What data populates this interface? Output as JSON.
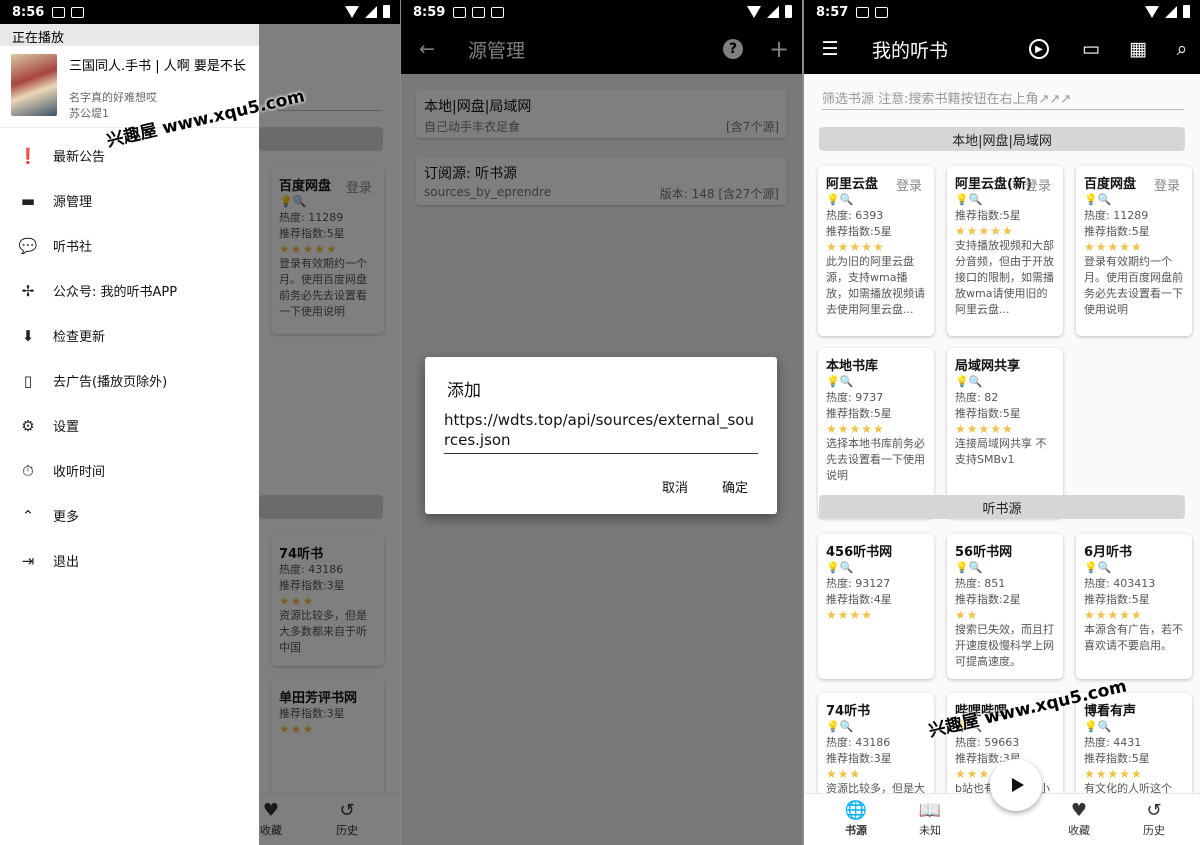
{
  "panel1": {
    "status": {
      "time": "8:56"
    },
    "now_playing": {
      "header": "正在播放",
      "title": "三国同人.手书 | 人啊 要是不长",
      "subtitle1": "名字真的好难想哎",
      "subtitle2": "苏公堤1"
    },
    "menu": [
      {
        "label": "最新公告",
        "icon": "announcement-icon",
        "glyph": "❗"
      },
      {
        "label": "源管理",
        "icon": "folder-icon",
        "glyph": "▬"
      },
      {
        "label": "听书社",
        "icon": "forum-icon",
        "glyph": "💬"
      },
      {
        "label": "公众号: 我的听书APP",
        "icon": "pinwheel-icon",
        "glyph": "✢"
      },
      {
        "label": "检查更新",
        "icon": "update-icon",
        "glyph": "⬇"
      },
      {
        "label": "去广告(播放页除外)",
        "icon": "phone-icon",
        "glyph": "▯"
      },
      {
        "label": "设置",
        "icon": "settings-icon",
        "glyph": "⚙"
      },
      {
        "label": "收听时间",
        "icon": "timer-icon",
        "glyph": "⏱"
      },
      {
        "label": "更多",
        "icon": "expand-icon",
        "glyph": "⌃"
      },
      {
        "label": "退出",
        "icon": "exit-icon",
        "glyph": "⇥"
      }
    ],
    "bg_card1": {
      "title": "百度网盘",
      "login": "登录",
      "hot": "热度: 11289",
      "rec": "推荐指数:5星",
      "desc": "登录有效期约一个月。使用百度网盘前务必先去设置看一下使用说明"
    },
    "bg_card2": {
      "title": "74听书",
      "hot": "热度: 43186",
      "rec": "推荐指数:3星",
      "desc": "资源比较多，但是大多数都来自于听中国"
    },
    "bg_card3": {
      "title": "单田芳评书网",
      "rec": "推荐指数:3星"
    },
    "nav": {
      "fav": "收藏",
      "history": "历史"
    },
    "watermark": "兴趣屋 www.xqu5.com"
  },
  "panel2": {
    "status": {
      "time": "8:59"
    },
    "title": "源管理",
    "sources": [
      {
        "title": "本地|网盘|局域网",
        "sub": "自己动手丰衣足食",
        "right": "[含7个源]"
      },
      {
        "title": "订阅源: 听书源",
        "sub": "sources_by_eprendre",
        "right": "版本: 148 [含27个源]"
      }
    ],
    "dialog": {
      "title": "添加",
      "input_value": "https://wdts.top/api/sources/external_sources.json",
      "cancel": "取消",
      "ok": "确定"
    }
  },
  "panel3": {
    "status": {
      "time": "8:57"
    },
    "title": "我的听书",
    "filter_placeholder": "筛选书源 注意:搜索书籍按钮在右上角↗↗↗",
    "section1": "本地|网盘|局域网",
    "section2": "听书源",
    "cards1": [
      {
        "title": "阿里云盘",
        "login": "登录",
        "hot": "热度: 6393",
        "rec": "推荐指数:5星",
        "stars": "★★★★★",
        "desc": "此为旧的阿里云盘源，支持wma播放，如需播放视频请去使用阿里云盘..."
      },
      {
        "title": "阿里云盘(新)",
        "login": "登录",
        "hot": "",
        "rec": "推荐指数:5星",
        "stars": "★★★★★",
        "desc": "支持播放视频和大部分音频，但由于开放接口的限制，如需播放wma请使用旧的阿里云盘..."
      },
      {
        "title": "百度网盘",
        "login": "登录",
        "hot": "热度: 11289",
        "rec": "推荐指数:5星",
        "stars": "★★★★★",
        "desc": "登录有效期约一个月。使用百度网盘前务必先去设置看一下使用说明"
      },
      {
        "title": "本地书库",
        "login": "",
        "hot": "热度: 9737",
        "rec": "推荐指数:5星",
        "stars": "★★★★★",
        "desc": "选择本地书库前务必先去设置看一下使用说明"
      },
      {
        "title": "局域网共享",
        "login": "",
        "hot": "热度: 82",
        "rec": "推荐指数:5星",
        "stars": "★★★★★",
        "desc": "连接局域网共享 不支持SMBv1"
      }
    ],
    "cards2": [
      {
        "title": "456听书网",
        "hot": "热度: 93127",
        "rec": "推荐指数:4星",
        "stars": "★★★★",
        "desc": ""
      },
      {
        "title": "56听书网",
        "hot": "热度: 851",
        "rec": "推荐指数:2星",
        "stars": "★★",
        "desc": "搜索已失效，而且打开速度极慢科学上网可提高速度。"
      },
      {
        "title": "6月听书",
        "hot": "热度: 403413",
        "rec": "推荐指数:5星",
        "stars": "★★★★★",
        "desc": "本源含有广告，若不喜欢请不要启用。"
      },
      {
        "title": "74听书",
        "hot": "热度: 43186",
        "rec": "推荐指数:3星",
        "stars": "★★★",
        "desc": "资源比较多，但是大多数都来自于听"
      },
      {
        "title": "哔哩哔哩",
        "hot": "热度: 59663",
        "rec": "推荐指数:3星",
        "stars": "★★★",
        "desc": "b站也有很多有声小说，视频..."
      },
      {
        "title": "博看有声",
        "hot": "热度: 4431",
        "rec": "推荐指数:5星",
        "stars": "★★★★★",
        "desc": "有文化的人听这个"
      }
    ],
    "nav": [
      {
        "label": "书源",
        "icon": "globe-icon",
        "glyph": "🌐"
      },
      {
        "label": "未知",
        "icon": "book-icon",
        "glyph": "📖"
      },
      {
        "label": "收藏",
        "icon": "heart-icon",
        "glyph": "♥"
      },
      {
        "label": "历史",
        "icon": "history-icon",
        "glyph": "↺"
      }
    ],
    "watermark": "兴趣屋 www.xqu5.com"
  }
}
